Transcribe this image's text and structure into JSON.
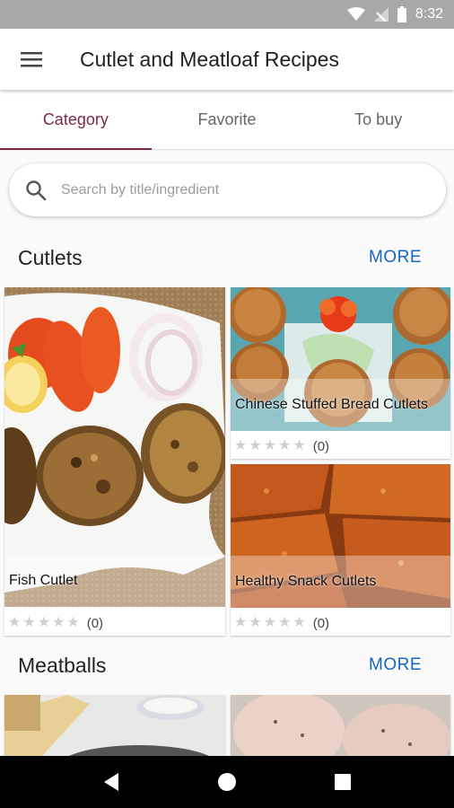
{
  "status_bar": {
    "time": "8:32"
  },
  "app_bar": {
    "title": "Cutlet and Meatloaf Recipes"
  },
  "tabs": [
    {
      "label": "Category",
      "active": true
    },
    {
      "label": "Favorite",
      "active": false
    },
    {
      "label": "To buy",
      "active": false
    }
  ],
  "search": {
    "placeholder": "Search by title/ingredient",
    "value": ""
  },
  "sections": [
    {
      "title": "Cutlets",
      "more_label": "MORE",
      "cards": [
        {
          "title": "Fish Cutlet",
          "rating_count": "(0)",
          "stars_filled": 0
        },
        {
          "title": "Chinese Stuffed Bread Cutlets",
          "rating_count": "(0)",
          "stars_filled": 0
        },
        {
          "title": "Healthy Snack Cutlets",
          "rating_count": "(0)",
          "stars_filled": 0
        }
      ]
    },
    {
      "title": "Meatballs",
      "more_label": "MORE"
    }
  ],
  "colors": {
    "accent": "#7a2a3f",
    "link": "#1565c0",
    "status_bar": "#a8a8a8",
    "nav_bar": "#000000"
  },
  "icons": {
    "status": [
      "wifi-icon",
      "signal-icon",
      "battery-icon"
    ],
    "app_bar": "menu-icon",
    "search": "search-icon",
    "nav": [
      "back-icon",
      "home-icon",
      "recents-icon"
    ]
  }
}
